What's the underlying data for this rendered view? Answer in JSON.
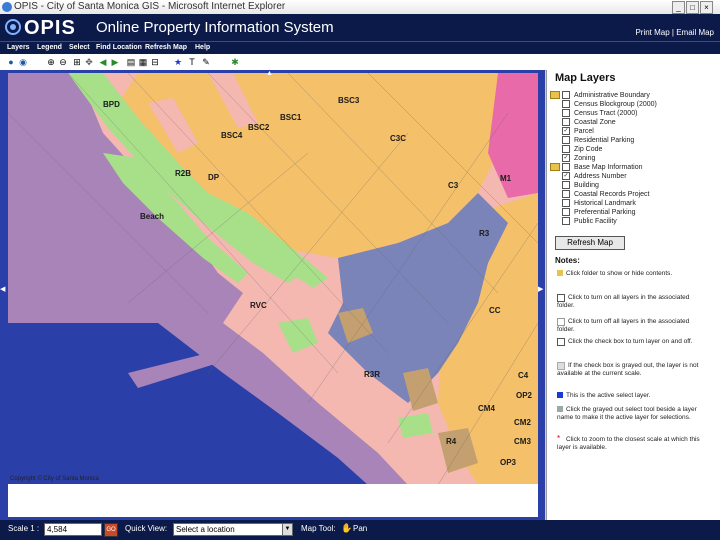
{
  "window": {
    "title": "OPIS - City of Santa Monica GIS - Microsoft Internet Explorer",
    "buttons": [
      "_",
      "□",
      "×"
    ]
  },
  "header": {
    "logo": "OPIS",
    "app_title": "Online Property Information System",
    "links": "Print Map | Email Map"
  },
  "menu": {
    "items": [
      "Layers",
      "Legend",
      "Select",
      "Find Location",
      "Refresh Map",
      "Help"
    ]
  },
  "toolbar": {
    "tools": [
      "globe-icon",
      "info-icon",
      "zoom-in-icon",
      "zoom-out-icon",
      "full-extent-icon",
      "pan-icon",
      "back-icon",
      "forward-icon",
      "identify-icon",
      "select-icon",
      "measure-icon",
      "star-icon",
      "text-icon",
      "pencil-icon",
      "clear-icon"
    ]
  },
  "map": {
    "zones": [
      "BPD",
      "BSC3",
      "BSC1",
      "BSC2",
      "BSC4",
      "C3C",
      "R2B",
      "DP",
      "C3",
      "M1",
      "Beach",
      "R3",
      "RVC",
      "CC",
      "R3R",
      "C4",
      "OP2",
      "CM4",
      "CM2",
      "R4",
      "CM3",
      "OP3"
    ],
    "copyright": "Copyright © City of Santa Monica",
    "colors": {
      "residential_pink": "#f4b8b0",
      "commercial_orange": "#f5c06a",
      "beach_purple": "#a884b8",
      "ocean_blue": "#2b3fa8",
      "civic_blue": "#7a84b8",
      "green": "#a8e08a",
      "magenta": "#e86aa8",
      "brown": "#c4a070"
    }
  },
  "panel": {
    "title": "Map Layers",
    "tree": [
      {
        "label": "Administrative Boundary",
        "checked": false,
        "folder": true
      },
      {
        "label": "Census Blockgroup (2000)",
        "checked": false
      },
      {
        "label": "Census Tract (2000)",
        "checked": false
      },
      {
        "label": "Coastal Zone",
        "checked": false
      },
      {
        "label": "Parcel",
        "checked": true
      },
      {
        "label": "Residential Parking",
        "checked": false
      },
      {
        "label": "Zip Code",
        "checked": false
      },
      {
        "label": "Zoning",
        "checked": true
      },
      {
        "label": "Base Map Information",
        "checked": false,
        "folder": true
      },
      {
        "label": "Address Number",
        "checked": true
      },
      {
        "label": "Building",
        "checked": false
      },
      {
        "label": "Coastal Records Project",
        "checked": false
      },
      {
        "label": "Historical Landmark",
        "checked": false
      },
      {
        "label": "Preferential Parking",
        "checked": false
      },
      {
        "label": "Public Facility",
        "checked": false
      }
    ],
    "refresh_label": "Refresh Map",
    "notes_title": "Notes:",
    "notes": [
      "Click folder to show or hide contents.",
      "Click to turn on all layers in the associated folder.",
      "Click to turn off all layers in the associated folder.",
      "Click the check box to turn layer on and off.",
      "If the check box is grayed out, the layer is not available at the current scale.",
      "This is the active select layer.",
      "Click the grayed out select tool beside a layer name to make it the active layer for selections.",
      "Click to zoom to the closest scale at which this layer is available."
    ]
  },
  "status": {
    "scale_label": "Scale 1 :",
    "scale_value": "4,584",
    "quickview_label": "Quick View:",
    "quickview_value": "Select a location",
    "maptool_label": "Map Tool:",
    "maptool_value": "Pan"
  }
}
